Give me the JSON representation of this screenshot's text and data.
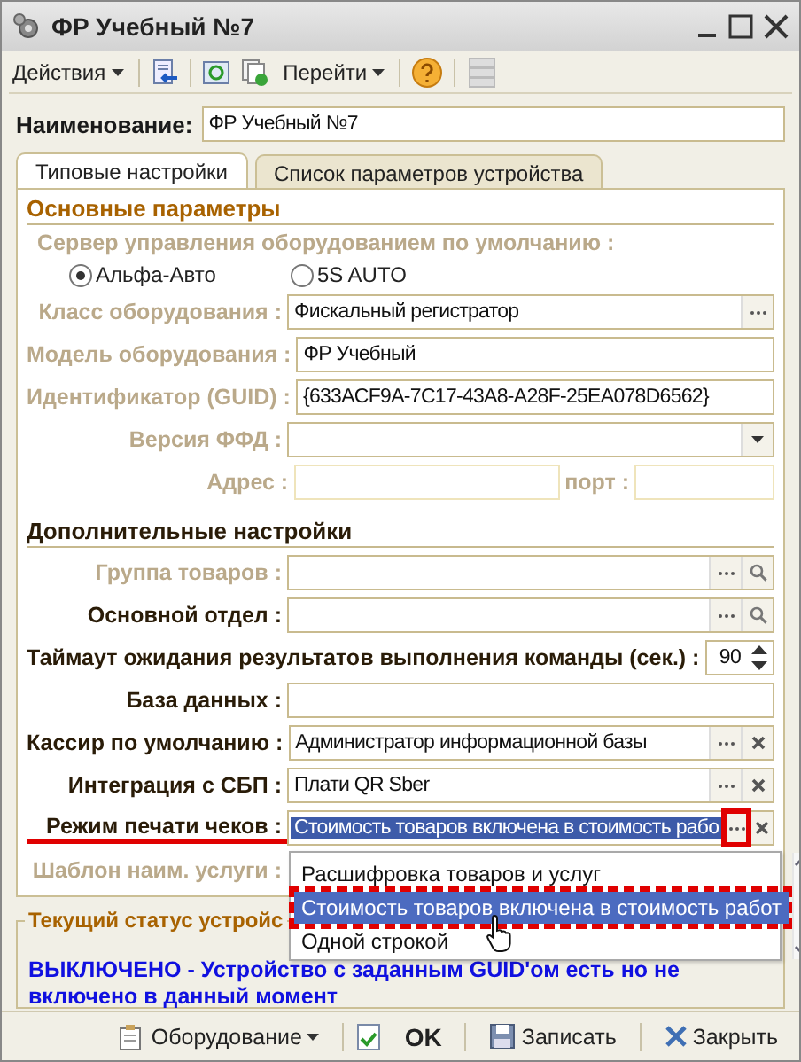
{
  "window": {
    "title": "ФР Учебный №7"
  },
  "toolbar": {
    "menus": [
      "Действия",
      "Перейти"
    ]
  },
  "name_field": {
    "label": "Наименование:",
    "value": "ФР Учебный №7"
  },
  "tabs": [
    {
      "label": "Типовые настройки",
      "selected": true
    },
    {
      "label": "Список параметров устройства",
      "selected": false
    }
  ],
  "main_section": {
    "title": "Основные параметры",
    "server": {
      "label": "Сервер управления оборудованием по умолчанию :",
      "disabled": true,
      "options": [
        {
          "label": "Альфа-Авто",
          "selected": true
        },
        {
          "label": "5S AUTO",
          "selected": false
        }
      ]
    },
    "fields": [
      {
        "kind": "text",
        "label": "Класс оборудования :",
        "value": "Фискальный регистратор",
        "disabled": true,
        "select_button": true
      },
      {
        "kind": "text",
        "label": "Модель оборудования :",
        "value": "ФР Учебный",
        "disabled": true
      },
      {
        "kind": "text",
        "label": "Идентификатор (GUID) :",
        "value": "{633ACF9A-7C17-43A8-A28F-25EA078D6562}",
        "disabled": true
      },
      {
        "kind": "dropdown",
        "label": "Версия ФФД :",
        "disabled": true
      },
      {
        "kind": "address",
        "label": "Адрес :",
        "port_label": "порт :",
        "disabled": true
      }
    ]
  },
  "extra_section": {
    "title": "Дополнительные настройки",
    "fields": [
      {
        "kind": "text",
        "label": "Группа товаров :",
        "disabled": true,
        "select_button": true,
        "search_button": true
      },
      {
        "kind": "text",
        "label": "Основной отдел :",
        "disabled": false,
        "select_button": true,
        "search_button": true
      },
      {
        "kind": "spin",
        "label": "Таймаут ожидания результатов выполнения команды (сек.) :",
        "value": "90",
        "disabled": false
      },
      {
        "kind": "text",
        "label": "База данных :",
        "disabled": false
      },
      {
        "kind": "text",
        "label": "Кассир по умолчанию :",
        "value": "Администратор информационной базы",
        "disabled": false,
        "select_button": true,
        "clear_button": true
      },
      {
        "kind": "text",
        "label": "Интеграция с СБП :",
        "value": "Плати QR Sber",
        "disabled": false,
        "select_button": true,
        "clear_button": true
      },
      {
        "kind": "text",
        "label": "Режим печати чеков :",
        "value": "Стоимость товаров включена в стоимость рабо",
        "disabled": false,
        "focused": true,
        "annotated": true,
        "select_button": true,
        "clear_button": true
      },
      {
        "kind": "covered",
        "label": "Шаблон наим. услуги :",
        "disabled": true
      }
    ]
  },
  "dropdown": {
    "options": [
      {
        "label": "Расшифровка товаров и услуг",
        "selected": false,
        "annotated": false
      },
      {
        "label": "Стоимость товаров включена в стоимость работ",
        "selected": true,
        "annotated": true
      },
      {
        "label": "Одной строкой",
        "selected": false,
        "annotated": false
      }
    ]
  },
  "status": {
    "title": "Текущий статус устройс",
    "message": "ВЫКЛЮЧЕНО - Устройство с заданным GUID'ом есть но не включено в данный момент"
  },
  "bottom_bar": {
    "menu": "Оборудование",
    "ok": "OK",
    "buttons": [
      {
        "kind": "save",
        "label": "Записать"
      },
      {
        "kind": "close",
        "label": "Закрыть"
      }
    ]
  }
}
